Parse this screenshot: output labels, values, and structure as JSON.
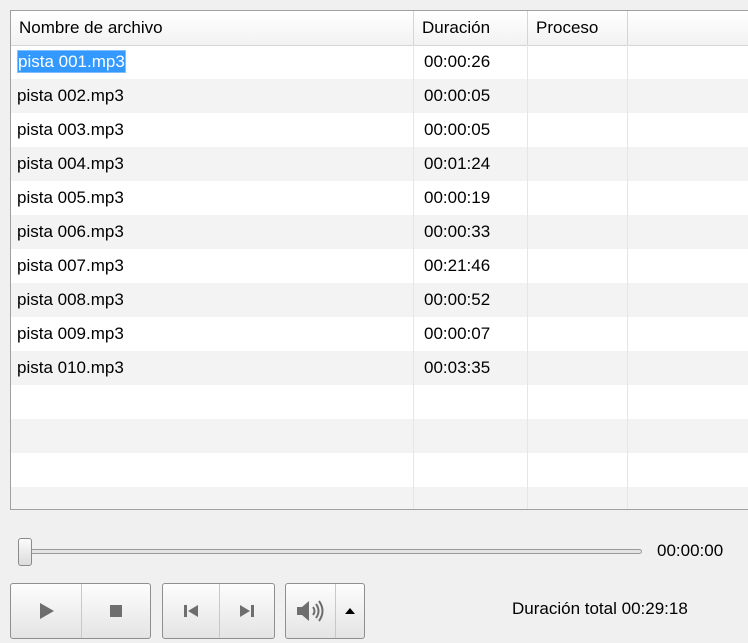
{
  "columns": [
    "Nombre de archivo",
    "Duración",
    "Proceso",
    ""
  ],
  "tracks": [
    {
      "name": "pista 001.mp3",
      "duration": "00:00:26",
      "process": ""
    },
    {
      "name": "pista 002.mp3",
      "duration": "00:00:05",
      "process": ""
    },
    {
      "name": "pista 003.mp3",
      "duration": "00:00:05",
      "process": ""
    },
    {
      "name": "pista 004.mp3",
      "duration": "00:01:24",
      "process": ""
    },
    {
      "name": "pista 005.mp3",
      "duration": "00:00:19",
      "process": ""
    },
    {
      "name": "pista 006.mp3",
      "duration": "00:00:33",
      "process": ""
    },
    {
      "name": "pista 007.mp3",
      "duration": "00:21:46",
      "process": ""
    },
    {
      "name": "pista 008.mp3",
      "duration": "00:00:52",
      "process": ""
    },
    {
      "name": "pista 009.mp3",
      "duration": "00:00:07",
      "process": ""
    },
    {
      "name": "pista 010.mp3",
      "duration": "00:03:35",
      "process": ""
    }
  ],
  "selected_index": 0,
  "player": {
    "position": "00:00:00",
    "progress": 0,
    "total_label": "Duración total",
    "total_value": "00:29:18",
    "icons": {
      "play": "play-icon",
      "stop": "stop-icon",
      "previous": "skip-previous-icon",
      "next": "skip-next-icon",
      "volume": "speaker-volume-icon",
      "volume_menu": "caret-up-icon"
    }
  },
  "colors": {
    "selection": "#3399ff",
    "alt_row": "#f3f3f3",
    "icon": "#6e6e6e"
  }
}
